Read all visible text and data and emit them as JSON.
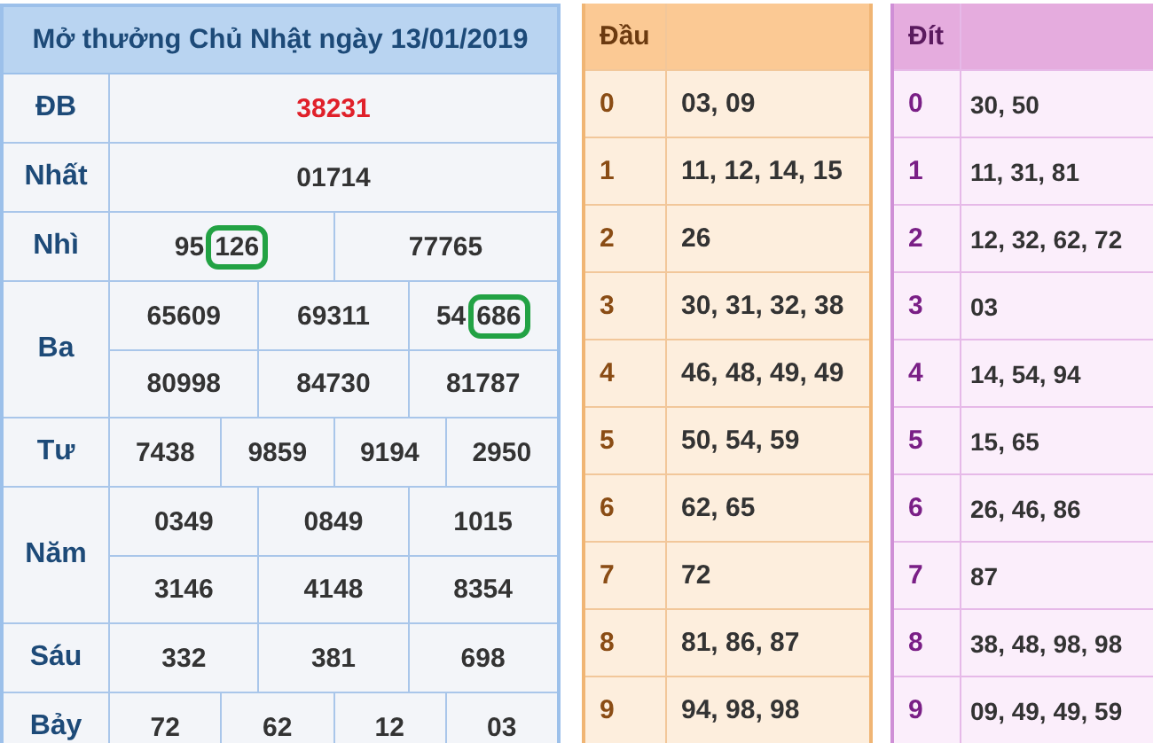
{
  "results": {
    "title": "Mở thưởng Chủ Nhật ngày 13/01/2019",
    "prizes": [
      {
        "label": "ĐB",
        "kind": "special",
        "lines": [
          [
            {
              "value": "38231"
            }
          ]
        ]
      },
      {
        "label": "Nhất",
        "kind": "normal",
        "lines": [
          [
            {
              "value": "01714"
            }
          ]
        ]
      },
      {
        "label": "Nhì",
        "kind": "normal",
        "lines": [
          [
            {
              "plain": "95",
              "circled": "126"
            },
            {
              "value": "77765"
            }
          ]
        ]
      },
      {
        "label": "Ba",
        "kind": "normal",
        "lines": [
          [
            {
              "value": "65609"
            },
            {
              "value": "69311"
            },
            {
              "plain": "54",
              "circled": "686"
            }
          ],
          [
            {
              "value": "80998"
            },
            {
              "value": "84730"
            },
            {
              "value": "81787"
            }
          ]
        ]
      },
      {
        "label": "Tư",
        "kind": "normal",
        "lines": [
          [
            {
              "value": "7438"
            },
            {
              "value": "9859"
            },
            {
              "value": "9194"
            },
            {
              "value": "2950"
            }
          ]
        ]
      },
      {
        "label": "Năm",
        "kind": "normal",
        "lines": [
          [
            {
              "value": "0349"
            },
            {
              "value": "0849"
            },
            {
              "value": "1015"
            }
          ],
          [
            {
              "value": "3146"
            },
            {
              "value": "4148"
            },
            {
              "value": "8354"
            }
          ]
        ]
      },
      {
        "label": "Sáu",
        "kind": "normal",
        "lines": [
          [
            {
              "value": "332"
            },
            {
              "value": "381"
            },
            {
              "value": "698"
            }
          ]
        ]
      },
      {
        "label": "Bảy",
        "kind": "normal",
        "lines": [
          [
            {
              "value": "72"
            },
            {
              "value": "62"
            },
            {
              "value": "12"
            },
            {
              "value": "03"
            }
          ]
        ]
      }
    ]
  },
  "tables": [
    {
      "kind": "head",
      "header": "Đầu",
      "rows": [
        {
          "digit": "0",
          "numbers": "03, 09"
        },
        {
          "digit": "1",
          "numbers": "11, 12, 14, 15"
        },
        {
          "digit": "2",
          "numbers": "26"
        },
        {
          "digit": "3",
          "numbers": "30, 31, 32, 38"
        },
        {
          "digit": "4",
          "numbers": "46, 48, 49, 49"
        },
        {
          "digit": "5",
          "numbers": "50, 54, 59"
        },
        {
          "digit": "6",
          "numbers": "62, 65"
        },
        {
          "digit": "7",
          "numbers": "72"
        },
        {
          "digit": "8",
          "numbers": "81, 86, 87"
        },
        {
          "digit": "9",
          "numbers": "94, 98, 98"
        }
      ]
    },
    {
      "kind": "tail",
      "header": "Đít",
      "rows": [
        {
          "digit": "0",
          "numbers": "30, 50"
        },
        {
          "digit": "1",
          "numbers": "11, 31, 81"
        },
        {
          "digit": "2",
          "numbers": "12, 32, 62, 72"
        },
        {
          "digit": "3",
          "numbers": "03"
        },
        {
          "digit": "4",
          "numbers": "14, 54, 94"
        },
        {
          "digit": "5",
          "numbers": "15, 65"
        },
        {
          "digit": "6",
          "numbers": "26, 46, 86"
        },
        {
          "digit": "7",
          "numbers": "87"
        },
        {
          "digit": "8",
          "numbers": "38, 48, 98, 98"
        },
        {
          "digit": "9",
          "numbers": "09, 49, 49, 59"
        }
      ]
    }
  ]
}
